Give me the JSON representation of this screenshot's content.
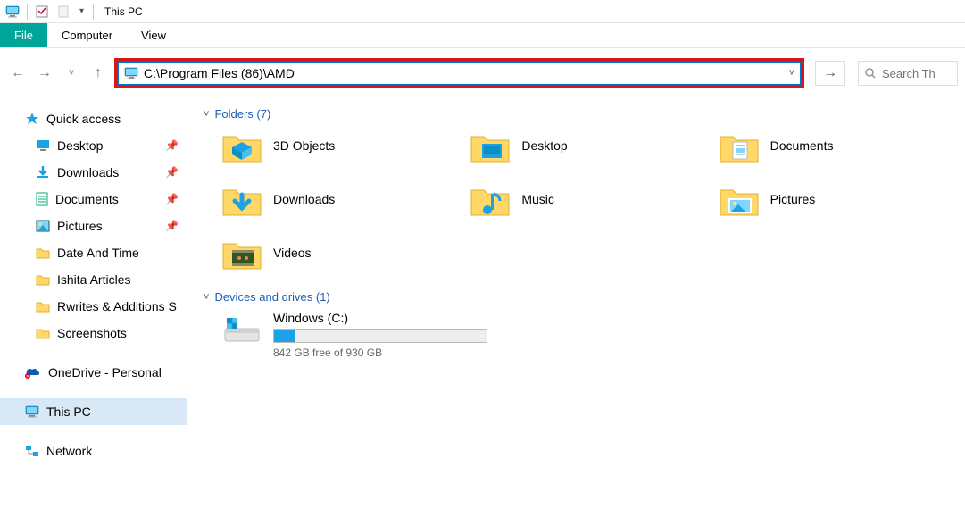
{
  "titlebar": {
    "title": "This PC"
  },
  "tabs": {
    "file": "File",
    "computer": "Computer",
    "view": "View"
  },
  "address": {
    "value": "C:\\Program Files (86)\\AMD"
  },
  "search": {
    "placeholder": "Search Th"
  },
  "sidebar": {
    "quick_access": "Quick access",
    "items": [
      {
        "label": "Desktop",
        "pinned": true
      },
      {
        "label": "Downloads",
        "pinned": true
      },
      {
        "label": "Documents",
        "pinned": true
      },
      {
        "label": "Pictures",
        "pinned": true
      },
      {
        "label": "Date And Time",
        "pinned": false
      },
      {
        "label": "Ishita Articles",
        "pinned": false
      },
      {
        "label": "Rwrites & Additions S",
        "pinned": false
      },
      {
        "label": "Screenshots",
        "pinned": false
      }
    ],
    "onedrive": "OneDrive - Personal",
    "thispc": "This PC",
    "network": "Network"
  },
  "content": {
    "folders_header": "Folders (7)",
    "folders": [
      {
        "name": "3D Objects"
      },
      {
        "name": "Desktop"
      },
      {
        "name": "Documents"
      },
      {
        "name": "Downloads"
      },
      {
        "name": "Music"
      },
      {
        "name": "Pictures"
      },
      {
        "name": "Videos"
      }
    ],
    "drives_header": "Devices and drives (1)",
    "drive": {
      "name": "Windows (C:)",
      "subtext": "842 GB free of 930 GB",
      "fill_pct": 10
    }
  }
}
